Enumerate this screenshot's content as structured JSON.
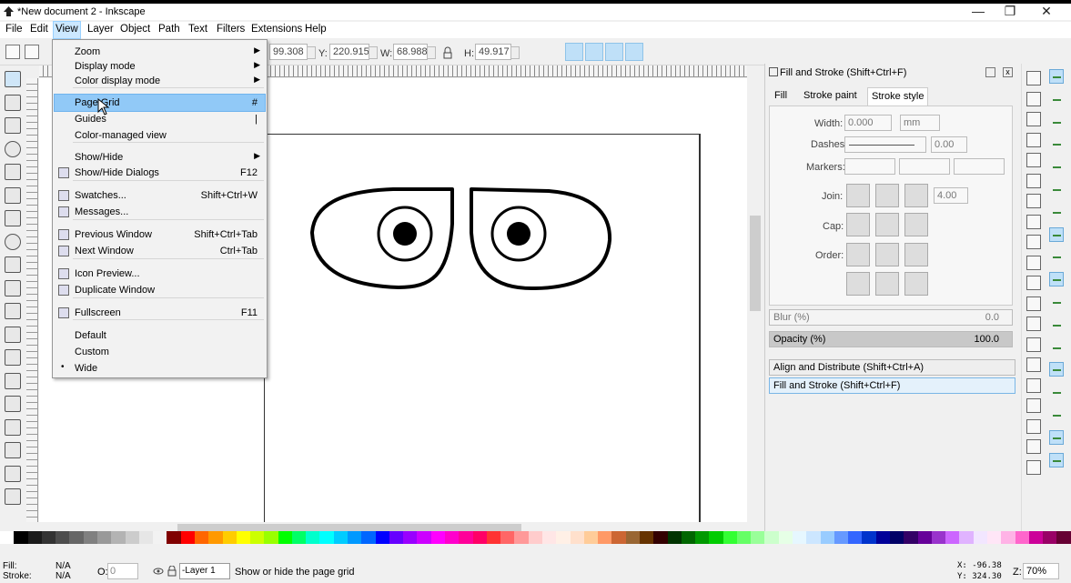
{
  "window": {
    "title": "*New document 2 - Inkscape",
    "minimize": "—",
    "maximize": "❐",
    "close": "✕"
  },
  "menubar": [
    "File",
    "Edit",
    "View",
    "Layer",
    "Object",
    "Path",
    "Text",
    "Filters",
    "Extensions",
    "Help"
  ],
  "toolbar": {
    "x_value": "99.308",
    "y_label": "Y:",
    "y_value": "220.915",
    "w_label": "W:",
    "w_value": "68.988",
    "h_label": "H:",
    "h_value": "49.917",
    "unit": "mm"
  },
  "view_menu": {
    "items": [
      {
        "label": "Zoom",
        "submenu": true
      },
      {
        "label": "Display mode",
        "submenu": true
      },
      {
        "label": "Color display mode",
        "submenu": true
      },
      {
        "label": "Page Grid",
        "accel": "#",
        "highlighted": true
      },
      {
        "label": "Guides",
        "accel": "|"
      },
      {
        "label": "Color-managed view"
      },
      {
        "label": "Show/Hide",
        "submenu": true
      },
      {
        "label": "Show/Hide Dialogs",
        "accel": "F12"
      },
      {
        "label": "Swatches...",
        "accel": "Shift+Ctrl+W"
      },
      {
        "label": "Messages..."
      },
      {
        "label": "Previous Window",
        "accel": "Shift+Ctrl+Tab"
      },
      {
        "label": "Next Window",
        "accel": "Ctrl+Tab"
      },
      {
        "label": "Icon Preview..."
      },
      {
        "label": "Duplicate Window"
      },
      {
        "label": "Fullscreen",
        "accel": "F11"
      },
      {
        "label": "Default"
      },
      {
        "label": "Custom"
      },
      {
        "label": "Wide",
        "checked": true,
        "bullet": "•"
      }
    ]
  },
  "fill_stroke": {
    "title": "Fill and Stroke (Shift+Ctrl+F)",
    "tabs": [
      "Fill",
      "Stroke paint",
      "Stroke style"
    ],
    "width_label": "Width:",
    "width_value": "0.000",
    "width_unit": "mm",
    "dashes_label": "Dashes:",
    "dashes_value": "0.00",
    "markers_label": "Markers:",
    "join_label": "Join:",
    "miter_value": "4.00",
    "cap_label": "Cap:",
    "order_label": "Order:",
    "blur_label": "Blur (%)",
    "blur_value": "0.0",
    "opacity_label": "Opacity (%)",
    "opacity_value": "100.0"
  },
  "docked": [
    "Align and Distribute (Shift+Ctrl+A)",
    "Fill and Stroke (Shift+Ctrl+F)"
  ],
  "status": {
    "fill_label": "Fill:",
    "fill_value": "N/A",
    "stroke_label": "Stroke:",
    "stroke_value": "N/A",
    "opacity_label": "O:",
    "opacity_value": "0",
    "layer": "-Layer 1",
    "message": "Show or hide the page grid",
    "x_coord": "X:  -96.38",
    "y_coord": "Y:  324.30",
    "zoom_label": "Z:",
    "zoom_value": "70%"
  },
  "palette": [
    "#ffffff",
    "#000000",
    "#1a1a1a",
    "#333333",
    "#4d4d4d",
    "#666666",
    "#808080",
    "#999999",
    "#b3b3b3",
    "#cccccc",
    "#e6e6e6",
    "#f2f2f2",
    "#800000",
    "#ff0000",
    "#ff6600",
    "#ff9900",
    "#ffcc00",
    "#ffff00",
    "#ccff00",
    "#99ff00",
    "#00ff00",
    "#00ff66",
    "#00ffcc",
    "#00ffff",
    "#00ccff",
    "#0099ff",
    "#0066ff",
    "#0000ff",
    "#6600ff",
    "#9900ff",
    "#cc00ff",
    "#ff00ff",
    "#ff00cc",
    "#ff0099",
    "#ff0066",
    "#ff3333",
    "#ff6666",
    "#ff9999",
    "#ffcccc",
    "#ffe6e6",
    "#fff0e6",
    "#ffe0cc",
    "#ffcc99",
    "#ff9966",
    "#cc6633",
    "#996633",
    "#663300",
    "#330000",
    "#003300",
    "#006600",
    "#009900",
    "#00cc00",
    "#33ff33",
    "#66ff66",
    "#99ff99",
    "#ccffcc",
    "#e6ffe6",
    "#e6f7ff",
    "#cce6ff",
    "#99ccff",
    "#6699ff",
    "#3366ff",
    "#0033cc",
    "#000099",
    "#000066",
    "#330066",
    "#660099",
    "#9933cc",
    "#cc66ff",
    "#e0b3ff",
    "#f2e6ff",
    "#ffe6f7",
    "#ffb3e6",
    "#ff66cc",
    "#cc0099",
    "#990066",
    "#660033"
  ],
  "colors": {
    "menu_highlight": "#91c9f7",
    "canvas": "#ffffff",
    "selection_blue": "#cce8ff"
  },
  "icons": {
    "toolbox": [
      "selector-icon",
      "node-icon",
      "tweak-icon",
      "zoom-icon",
      "measure-icon",
      "rect-icon",
      "3dbox-icon",
      "ellipse-icon",
      "star-icon",
      "spiral-icon",
      "pencil-icon",
      "pen-icon",
      "calligraphy-icon",
      "text-icon",
      "spray-icon",
      "eraser-icon",
      "bucket-icon",
      "gradient-icon",
      "mesh-icon"
    ],
    "commands": [
      "new-icon",
      "open-icon",
      "save-icon",
      "print-icon",
      "import-icon",
      "export-icon",
      "undo-icon",
      "redo-icon",
      "copy-icon",
      "cut-icon",
      "paste-icon",
      "zoom-selection-icon",
      "zoom-drawing-icon",
      "zoom-page-icon",
      "duplicate-icon",
      "clone-icon",
      "unlink-clone-icon",
      "group-icon",
      "ungroup-icon",
      "xml-editor-icon"
    ],
    "snap": [
      "snap-toggle-icon",
      "snap-bbox-icon",
      "snap-bbox-edge-icon",
      "snap-bbox-corner-icon",
      "snap-bbox-midpoint-icon",
      "snap-bbox-center-icon",
      "snap-nodes-icon",
      "snap-path-icon",
      "snap-intersection-icon",
      "snap-cusp-icon",
      "snap-smooth-icon",
      "snap-midpoint-icon",
      "snap-center-icon",
      "snap-rotation-icon",
      "snap-text-baseline-icon",
      "snap-page-border-icon",
      "snap-grid-icon",
      "snap-guide-icon"
    ]
  }
}
